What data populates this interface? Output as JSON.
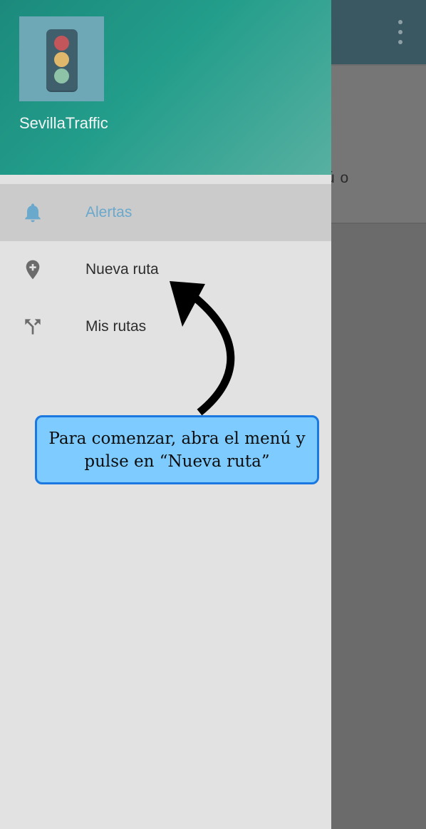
{
  "background": {
    "partial_text": "ú o"
  },
  "drawer": {
    "header": {
      "app_name": "SevillaTraffic",
      "logo_icon": "traffic-light-icon"
    },
    "items": [
      {
        "label": "Alertas",
        "icon": "bell-icon",
        "active": true
      },
      {
        "label": "Nueva ruta",
        "icon": "add-location-icon",
        "active": false
      },
      {
        "label": "Mis rutas",
        "icon": "fork-routes-icon",
        "active": false
      }
    ]
  },
  "tutorial": {
    "callout_text": "Para comenzar, abra el menú y pulse en “Nueva ruta”"
  },
  "colors": {
    "header_start": "#1b8a7c",
    "header_end": "#58b0a1",
    "active_item_text": "#6aa8cc",
    "callout_fill": "#7dcbff",
    "callout_border": "#1a78e0"
  }
}
